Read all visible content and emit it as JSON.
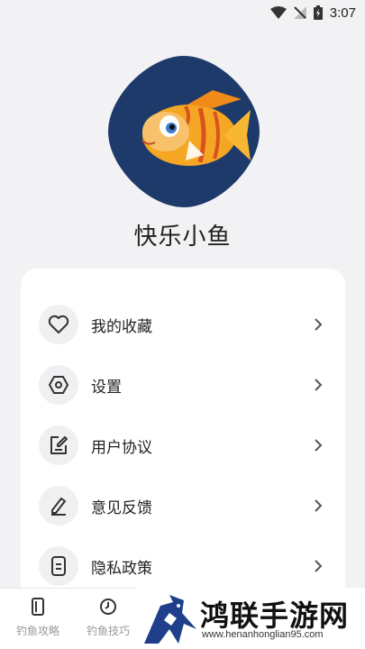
{
  "status_bar": {
    "time": "3:07"
  },
  "profile": {
    "username": "快乐小鱼"
  },
  "menu": {
    "items": [
      {
        "label": "我的收藏",
        "icon": "heart-icon"
      },
      {
        "label": "设置",
        "icon": "hexagon-settings-icon"
      },
      {
        "label": "用户协议",
        "icon": "edit-document-icon"
      },
      {
        "label": "意见反馈",
        "icon": "pen-icon"
      },
      {
        "label": "隐私政策",
        "icon": "document-icon"
      }
    ]
  },
  "bottom_nav": {
    "items": [
      {
        "label": "钓鱼攻略",
        "icon": "phone-icon"
      },
      {
        "label": "钓鱼技巧",
        "icon": "clock-icon"
      }
    ]
  },
  "watermark": {
    "text": "鸿联手游网",
    "url": "www.henanhonglian95.com"
  },
  "colors": {
    "avatar_bg": "#1d3a6b",
    "fish": "#f5a623",
    "card": "#ffffff",
    "page": "#f2f2f4"
  }
}
